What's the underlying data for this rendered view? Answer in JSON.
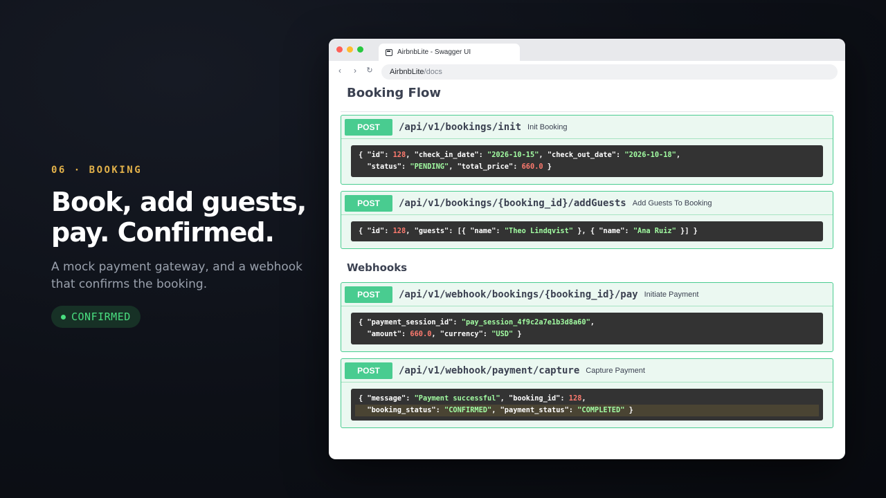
{
  "left": {
    "eyebrow": "06 · BOOKING",
    "headline_line1": "Book, add guests,",
    "headline_line2": "pay. Confirmed.",
    "subtitle_line1": "A mock payment gateway, and a webhook",
    "subtitle_line2": "that confirms the booking.",
    "status_pill": "CONFIRMED"
  },
  "browser": {
    "tab_title": "AirbnbLite - Swagger UI",
    "url_host": "AirbnbLite",
    "url_path": "/docs",
    "nav": {
      "back": "‹",
      "forward": "›",
      "reload": "↻"
    }
  },
  "sections": {
    "booking_flow": "Booking Flow",
    "webhooks": "Webhooks"
  },
  "operations": [
    {
      "method": "POST",
      "path": "/api/v1/bookings/init",
      "summary": "Init Booking"
    },
    {
      "method": "POST",
      "path": "/api/v1/bookings/{booking_id}/addGuests",
      "summary": "Add Guests To Booking"
    },
    {
      "method": "POST",
      "path": "/api/v1/webhook/bookings/{booking_id}/pay",
      "summary": "Initiate Payment"
    },
    {
      "method": "POST",
      "path": "/api/v1/webhook/payment/capture",
      "summary": "Capture Payment"
    }
  ],
  "responses": {
    "init": {
      "id": "128",
      "check_in_date": "\"2026-10-15\"",
      "check_out_date": "\"2026-10-18\"",
      "status": "\"PENDING\"",
      "total_price": "660.0"
    },
    "add_guests": {
      "id": "128",
      "guest1": "\"Theo Lindqvist\"",
      "guest2": "\"Ana Ruiz\""
    },
    "pay": {
      "payment_session_id": "\"pay_session_4f9c2a7e1b3d8a60\"",
      "amount": "660.0",
      "currency": "\"USD\""
    },
    "capture": {
      "message": "\"Payment successful\"",
      "booking_id": "128",
      "booking_status": "\"CONFIRMED\"",
      "payment_status": "\"COMPLETED\""
    }
  },
  "colors": {
    "accent_green": "#49cc90",
    "pill_text": "#4ade80",
    "eyebrow": "#e2b14a",
    "code_string": "#a2fca2",
    "code_number": "#fc7a6e"
  }
}
